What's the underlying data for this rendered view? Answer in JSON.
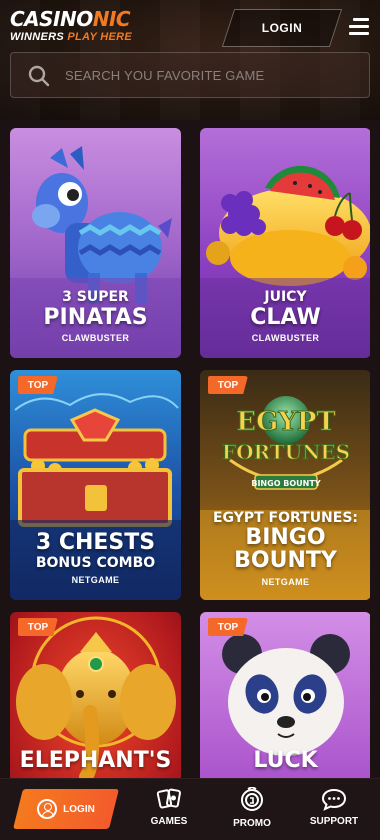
{
  "header": {
    "logo_main_white": "CASINO",
    "logo_main_orange": "NIC",
    "logo_sub_white": "WINNERS ",
    "logo_sub_orange": "PLAY HERE",
    "login_label": "LOGIN",
    "menu_icon": "hamburger-icon"
  },
  "search": {
    "placeholder": "SEARCH YOU FAVORITE GAME",
    "icon": "search-icon"
  },
  "games": [
    {
      "badge": "",
      "title_small": "3 SUPER",
      "title_big": "PINATAS",
      "provider": "CLAWBUSTER"
    },
    {
      "badge": "",
      "title_small": "JUICY",
      "title_big": "CLAW",
      "provider": "CLAWBUSTER"
    },
    {
      "badge": "TOP",
      "title_big": "3 CHESTS",
      "title_small": "BONUS COMBO",
      "provider": "NETGAME"
    },
    {
      "badge": "TOP",
      "title_small": "EGYPT FORTUNES:",
      "title_big1": "BINGO",
      "title_big2": "BOUNTY",
      "provider": "NETGAME",
      "logo_line1": "EGYPT",
      "logo_line2": "FORTUNES",
      "logo_line3": "BINGO BOUNTY"
    },
    {
      "badge": "TOP",
      "title_big": "ELEPHANT'S",
      "provider": ""
    },
    {
      "badge": "TOP",
      "title_big": "LUCK",
      "provider": ""
    }
  ],
  "bottom_nav": {
    "login_label": "LOGIN",
    "games_label": "GAMES",
    "promo_label": "PROMO",
    "support_label": "SUPPORT"
  },
  "colors": {
    "accent": "#f47a1f",
    "badge": "#f4682a",
    "background": "#1c1113"
  }
}
